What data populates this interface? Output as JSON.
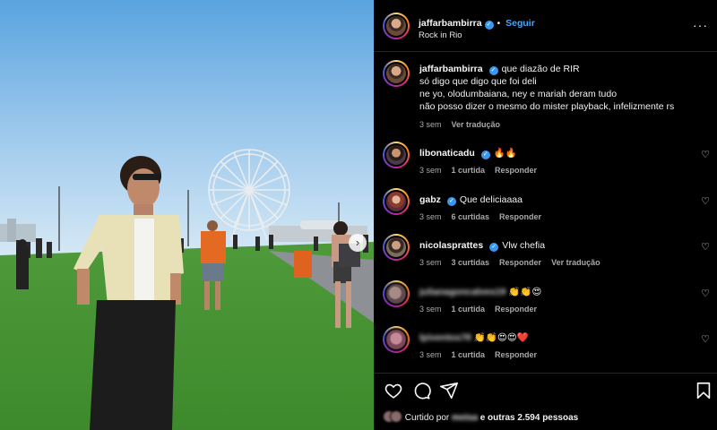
{
  "post": {
    "author": "jaffarbambirra",
    "follow_label": "Seguir",
    "location": "Rock in Rio",
    "caption_lines": [
      "que diazão de RIR",
      "só digo que digo que foi deli",
      "ne yo, olodumbaiana, ney e mariah deram tudo",
      "não posso dizer o mesmo do mister playback, infelizmente rs"
    ],
    "caption_time": "3 sem",
    "see_translation": "Ver tradução"
  },
  "comments": [
    {
      "user": "libonaticadu",
      "verified": true,
      "text": "🔥🔥",
      "time": "3 sem",
      "likes": "1 curtida",
      "reply": "Responder",
      "avatar": "av-b"
    },
    {
      "user": "gabz",
      "verified": true,
      "text": "Que deliciaaaa",
      "time": "3 sem",
      "likes": "6 curtidas",
      "reply": "Responder",
      "avatar": "av-c"
    },
    {
      "user": "nicolasprattes",
      "verified": true,
      "text": "Vlw chefia",
      "time": "3 sem",
      "likes": "3 curtidas",
      "reply": "Responder",
      "translate": "Ver tradução",
      "avatar": "av-d"
    },
    {
      "user": "julianagoncalves19",
      "verified": false,
      "text": "👏👏😍",
      "time": "3 sem",
      "likes": "1 curtida",
      "reply": "Responder",
      "avatar": "av-e",
      "blurred": true
    },
    {
      "user": "lpiventos78",
      "verified": false,
      "text": "👏👏😍😍❤️",
      "time": "3 sem",
      "likes": "1 curtida",
      "reply": "Responder",
      "avatar": "av-f",
      "blurred": true
    }
  ],
  "icons": {
    "like": "heart-icon",
    "comment": "comment-icon",
    "share": "share-icon",
    "save": "bookmark-icon",
    "more": "more-options-icon",
    "next": "chevron-right-icon"
  },
  "likes_summary": {
    "prefix": "Curtido por",
    "user": "moisa",
    "suffix": "e outras 2.594 pessoas"
  },
  "colors": {
    "background": "#000000",
    "accent": "#3897f0",
    "muted_text": "#a8a8a8"
  },
  "more_glyph": "···",
  "next_glyph": "›",
  "verified_glyph": "✓",
  "heart_glyph": "♡"
}
